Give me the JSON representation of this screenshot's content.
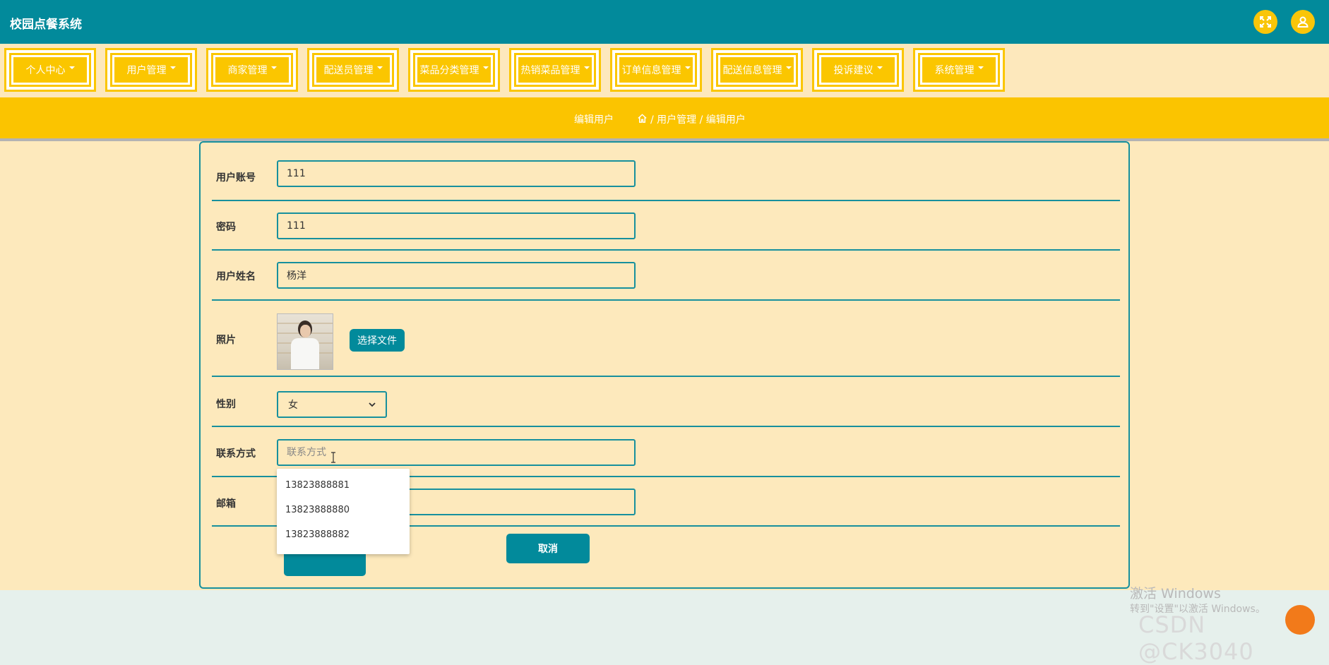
{
  "app": {
    "title": "校园点餐系统"
  },
  "header_icons": [
    {
      "name": "fullscreen-icon"
    },
    {
      "name": "user-icon"
    }
  ],
  "nav": [
    {
      "label": "个人中心"
    },
    {
      "label": "用户管理"
    },
    {
      "label": "商家管理"
    },
    {
      "label": "配送员管理"
    },
    {
      "label": "菜品分类管理"
    },
    {
      "label": "热销菜品管理"
    },
    {
      "label": "订单信息管理"
    },
    {
      "label": "配送信息管理"
    },
    {
      "label": "投诉建议"
    },
    {
      "label": "系统管理"
    }
  ],
  "breadcrumb": {
    "title": "编辑用户",
    "path": "/ 用户管理 / 编辑用户"
  },
  "form": {
    "account": {
      "label": "用户账号",
      "value": "111"
    },
    "password": {
      "label": "密码",
      "value": "111"
    },
    "name": {
      "label": "用户姓名",
      "value": "杨洋"
    },
    "photo": {
      "label": "照片",
      "button": "选择文件"
    },
    "gender": {
      "label": "性别",
      "value": "女"
    },
    "contact": {
      "label": "联系方式",
      "placeholder": "联系方式",
      "value": ""
    },
    "email": {
      "label": "邮箱",
      "value": ""
    },
    "cancel_label": "取消"
  },
  "autocomplete": [
    "13823888881",
    "13823888880",
    "13823888882"
  ],
  "watermark": {
    "line1": "激活 Windows",
    "line2": "转到\"设置\"以激活 Windows。",
    "csdn": "CSDN @CK3040"
  },
  "colors": {
    "teal": "#028a9b",
    "yellow": "#fbc600",
    "cream": "#fde9bc"
  }
}
